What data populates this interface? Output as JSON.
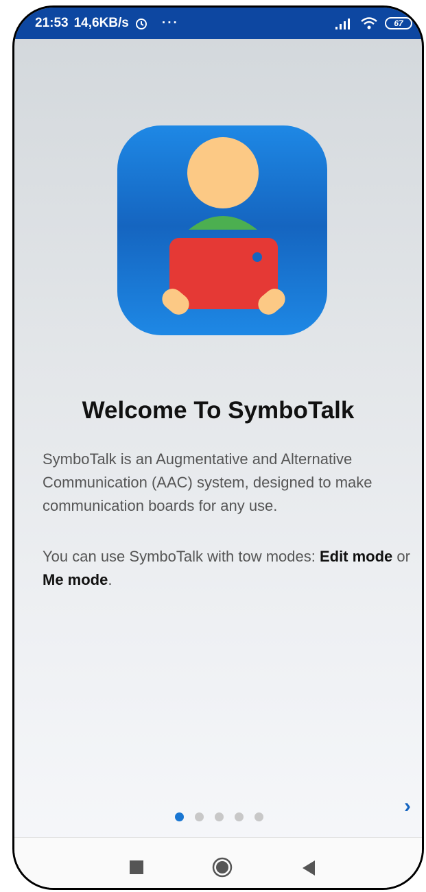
{
  "status_bar": {
    "time": "21:53",
    "speed": "14,6KB/s",
    "alarm_icon": "alarm-clock-icon",
    "more": "···",
    "battery": "67"
  },
  "welcome": {
    "title": "Welcome To SymboTalk",
    "description": "SymboTalk is an Augmentative and Alternative Communication (AAC) system, designed to make communication boards for any use.",
    "modes_prefix": "You can use SymboTalk with tow modes: ",
    "edit_mode": "Edit mode",
    "or": " or ",
    "me_mode": "Me mode",
    "suffix": "."
  },
  "pager": {
    "total": 5,
    "current": 1
  },
  "navigation": {
    "next_arrow": "›"
  },
  "colors": {
    "status_bar": "#0d47a1",
    "accent": "#1976d2",
    "icon_bg": "#1e88e5",
    "head": "#fcc985",
    "shirt": "#4caf50",
    "tablet": "#e53935"
  }
}
